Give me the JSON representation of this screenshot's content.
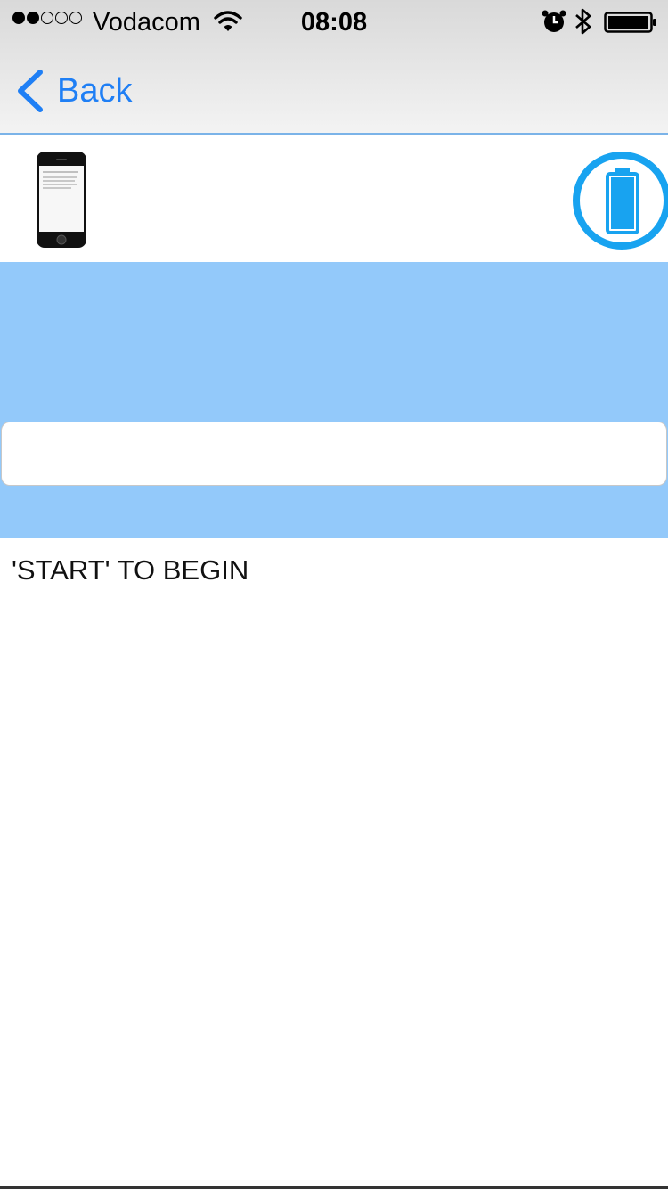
{
  "status_bar": {
    "carrier": "Vodacom",
    "time": "08:08",
    "signal_bars_filled": 2,
    "signal_bars_total": 5,
    "icons": [
      "wifi-icon",
      "alarm-icon",
      "bluetooth-icon",
      "battery-icon"
    ]
  },
  "nav": {
    "back_label": "Back",
    "back_icon": "chevron-left-icon"
  },
  "device_row": {
    "device_icon": "iphone-icon",
    "action_icon": "battery-icon"
  },
  "input": {
    "value": "",
    "placeholder": ""
  },
  "instruction": "'START' TO BEGIN",
  "colors": {
    "accent": "#1f7ff5",
    "panel_blue": "#93c9fa",
    "battery_blue": "#18a3f0"
  }
}
